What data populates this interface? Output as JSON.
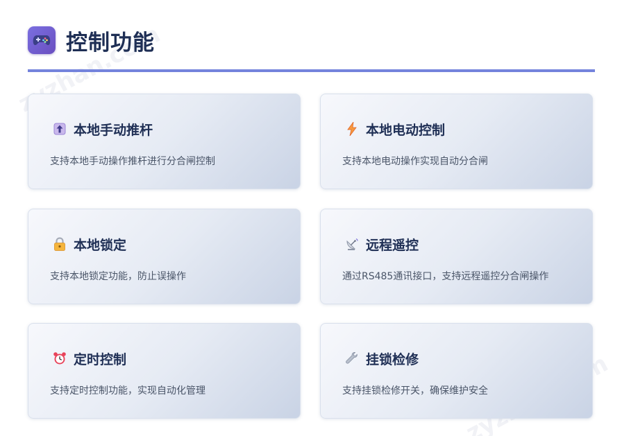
{
  "header": {
    "title": "控制功能",
    "icon": "gamepad-icon"
  },
  "watermark": "zyzhan.com",
  "colors": {
    "title": "#1f2f55",
    "accent_line": "#7483dc",
    "header_icon_bg": "#7060d0",
    "description": "#4a5568"
  },
  "cards": [
    {
      "title": "本地手动推杆",
      "description": "支持本地手动操作推杆进行分合闸控制",
      "icon": "up-arrow-box-icon"
    },
    {
      "title": "本地电动控制",
      "description": "支持本地电动操作实现自动分合闸",
      "icon": "lightning-icon"
    },
    {
      "title": "本地锁定",
      "description": "支持本地锁定功能，防止误操作",
      "icon": "lock-icon"
    },
    {
      "title": "远程遥控",
      "description": "通过RS485通讯接口，支持远程遥控分合闸操作",
      "icon": "satellite-antenna-icon"
    },
    {
      "title": "定时控制",
      "description": "支持定时控制功能，实现自动化管理",
      "icon": "alarm-clock-icon"
    },
    {
      "title": "挂锁检修",
      "description": "支持挂锁检修开关，确保维护安全",
      "icon": "wrench-icon"
    }
  ]
}
